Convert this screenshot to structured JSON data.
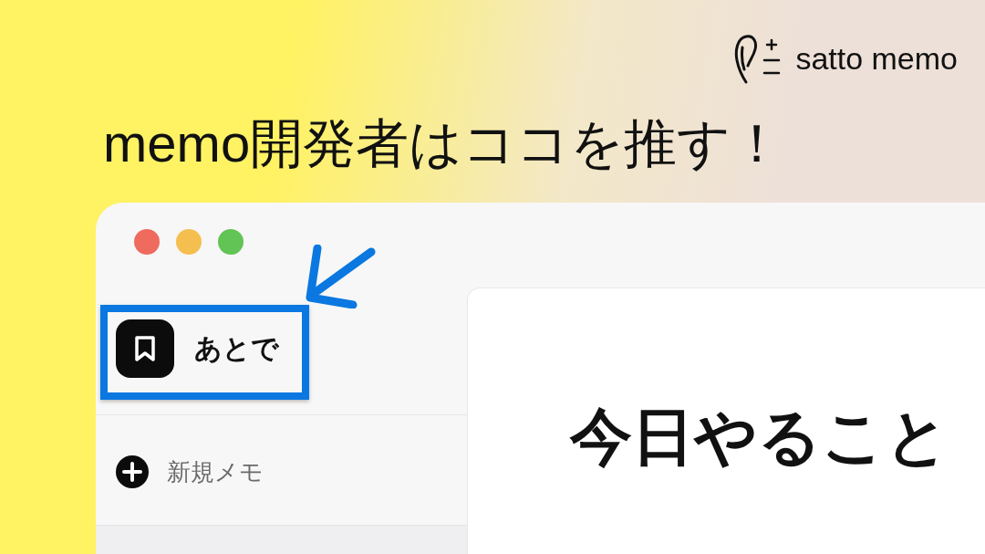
{
  "brand": {
    "name": "satto memo"
  },
  "headline": "memo開発者はココを推す！",
  "sidebar": {
    "items": [
      {
        "kind": "saved",
        "label": "あとで",
        "highlighted": true
      },
      {
        "kind": "new",
        "label": "新規メモ",
        "highlighted": false
      }
    ]
  },
  "note": {
    "title": "今日やること"
  }
}
